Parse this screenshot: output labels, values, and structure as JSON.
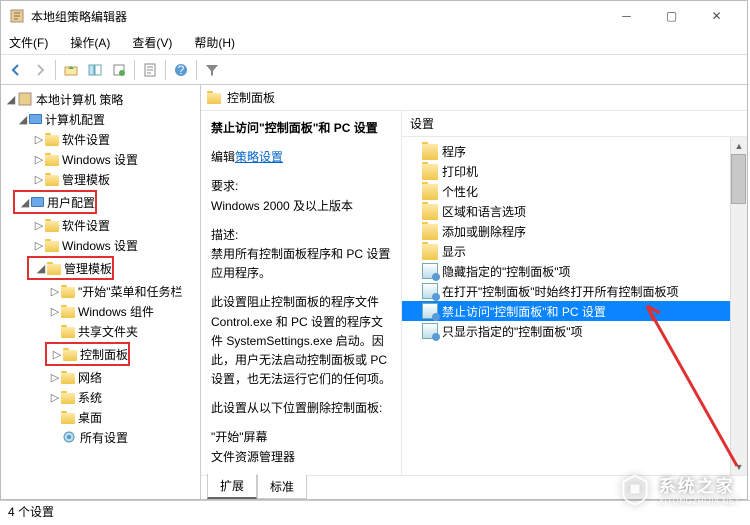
{
  "title": "本地组策略编辑器",
  "menu": {
    "file": "文件(F)",
    "action": "操作(A)",
    "view": "查看(V)",
    "help": "帮助(H)"
  },
  "tree": {
    "root": "本地计算机 策略",
    "computer": "计算机配置",
    "c_soft": "软件设置",
    "c_win": "Windows 设置",
    "c_admin": "管理模板",
    "user": "用户配置",
    "u_soft": "软件设置",
    "u_win": "Windows 设置",
    "u_admin": "管理模板",
    "start": "\"开始\"菜单和任务栏",
    "wincomp": "Windows 组件",
    "shared": "共享文件夹",
    "control": "控制面板",
    "network": "网络",
    "system": "系统",
    "desktop": "桌面",
    "all": "所有设置"
  },
  "panel": {
    "header": "控制面板",
    "title": "禁止访问\"控制面板\"和 PC 设置",
    "edit_prefix": "编辑",
    "edit_link": "策略设置",
    "req_label": "要求:",
    "req_text": "Windows 2000 及以上版本",
    "desc_label": "描述:",
    "desc1": "禁用所有控制面板程序和 PC 设置应用程序。",
    "desc2": "此设置阻止控制面板的程序文件 Control.exe 和 PC 设置的程序文件 SystemSettings.exe 启动。因此，用户无法启动控制面板或 PC 设置，也无法运行它们的任何项。",
    "desc3": "此设置从以下位置删除控制面板:",
    "desc4": "\"开始\"屏幕",
    "desc5": "文件资源管理器"
  },
  "right": {
    "header": "设置",
    "items": {
      "programs": "程序",
      "printers": "打印机",
      "personal": "个性化",
      "region": "区域和语言选项",
      "addremove": "添加或删除程序",
      "display": "显示",
      "hide": "隐藏指定的\"控制面板\"项",
      "open": "在打开\"控制面板\"时始终打开所有控制面板项",
      "prohibit": "禁止访问\"控制面板\"和 PC 设置",
      "showonly": "只显示指定的\"控制面板\"项"
    }
  },
  "tabs": {
    "ext": "扩展",
    "std": "标准"
  },
  "status": "4 个设置",
  "watermark": {
    "text": "系统之家",
    "sub": "XITONGZHIJIA.NET"
  }
}
